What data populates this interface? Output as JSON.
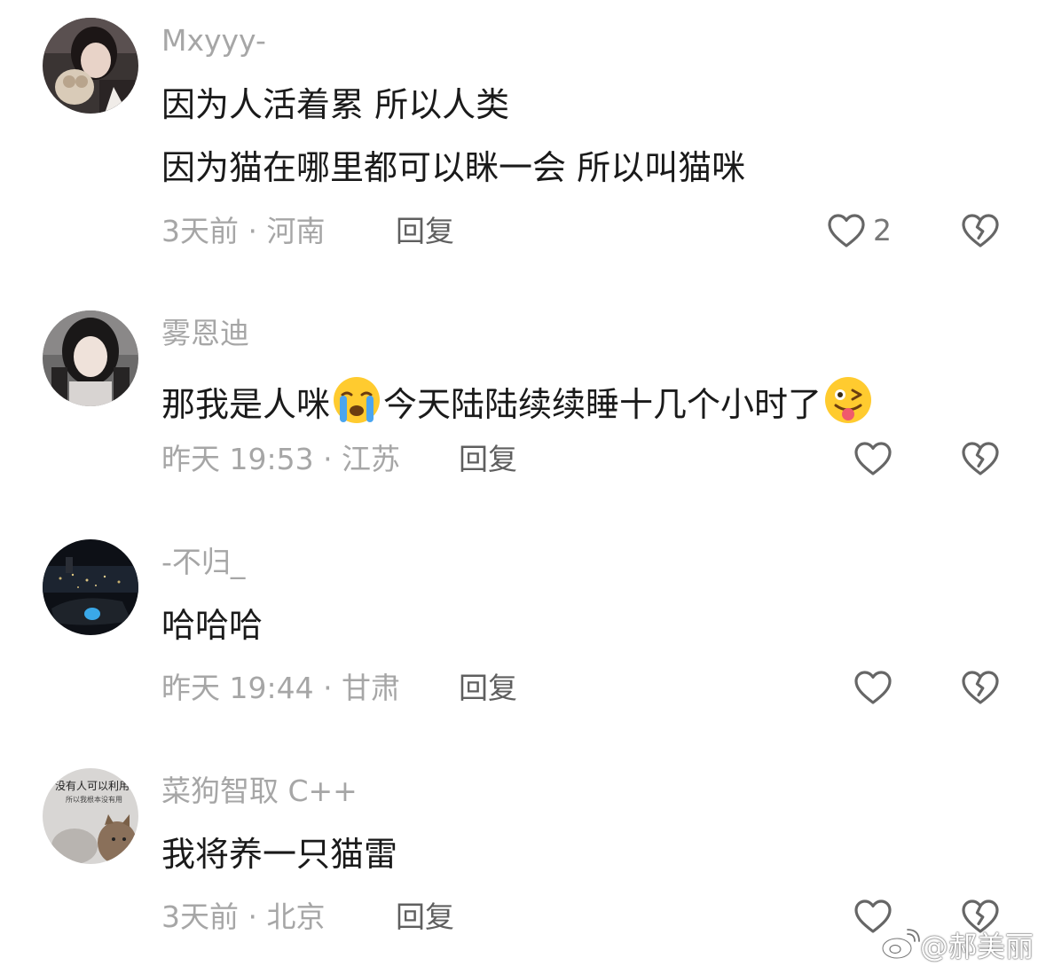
{
  "comments": [
    {
      "username": "Mxyyy-",
      "lines": [
        "因为人活着累 所以人类",
        "因为猫在哪里都可以眯一会 所以叫猫咪"
      ],
      "time": "3天前 · 河南",
      "reply": "回复",
      "likes": "2"
    },
    {
      "username": "雾恩迪",
      "text_a": "那我是人咪",
      "text_b": "今天陆陆续续睡十几个小时了",
      "time": "昨天 19:53 · 江苏",
      "reply": "回复"
    },
    {
      "username": "-不归_",
      "text": "哈哈哈",
      "time": "昨天 19:44 · 甘肃",
      "reply": "回复"
    },
    {
      "username": "菜狗智取 C++",
      "text": "我将养一只猫雷",
      "time": "3天前 · 北京",
      "reply": "回复",
      "avatar_text": [
        "没有人可以利用",
        "所以我根本没有用"
      ]
    }
  ],
  "watermark": "@郝美丽",
  "icons": {
    "like": "heart-outline-icon",
    "dislike": "broken-heart-icon",
    "crying_emoji": "crying-face-emoji-icon",
    "tongue_emoji": "winking-tongue-face-emoji-icon",
    "watermark_logo": "weibo-logo-icon"
  },
  "colors": {
    "username": "#a6a6a6",
    "text": "#1a1a1a",
    "meta": "#a6a6a6",
    "icon": "#666666"
  }
}
